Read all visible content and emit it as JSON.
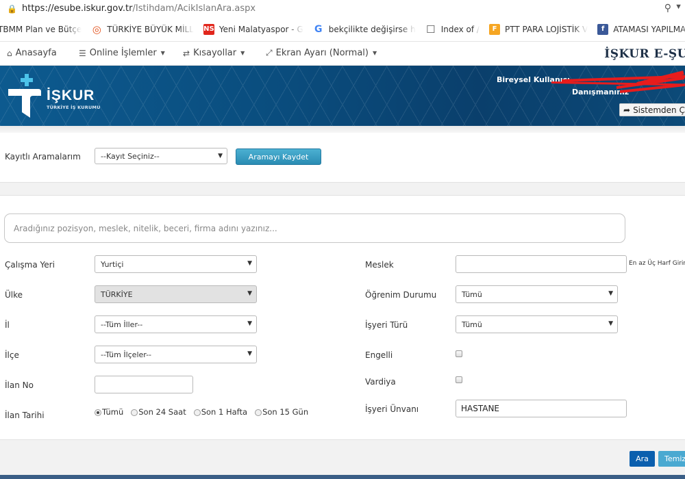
{
  "browser": {
    "url_host": "https://esube.iskur.gov.tr",
    "url_path": "/Istihdam/AcikIslanAra.aspx",
    "bookmarks": [
      {
        "label": "TBMM Plan ve Bütçe",
        "icon": "tbmm-icon",
        "color": "#ffffff"
      },
      {
        "label": "TÜRKİYE BÜYÜK MİLL",
        "icon": "tbmm-seal-icon",
        "color": "#e3541f"
      },
      {
        "label": "Yeni Malatyaspor - G",
        "icon": "malatyaspor-icon",
        "color": "#e1261c"
      },
      {
        "label": "bekçilikte değişirse h",
        "icon": "google-icon",
        "color": "#4285f4"
      },
      {
        "label": "Index of /",
        "icon": "document-icon",
        "color": "#555555"
      },
      {
        "label": "PTT PARA LOJİSTİK V",
        "icon": "ptt-icon",
        "color": "#f6a623"
      },
      {
        "label": "ATAMASI YAPILMAYA",
        "icon": "facebook-icon",
        "color": "#3b5998"
      }
    ]
  },
  "nav": {
    "home": "Anasayfa",
    "online": "Online İşlemler",
    "shortcuts": "Kısayollar",
    "screen": "Ekran Ayarı (Normal)",
    "brand": "İŞKUR E-ŞU"
  },
  "header": {
    "logo_text": "İŞKUR",
    "logo_sub": "TÜRKİYE İŞ KURUMU",
    "user_label": "Bireysel Kullanıcı",
    "consultant_label": "Danışmanınız",
    "logout": "Sistemden Ç"
  },
  "saved": {
    "label": "Kayıtlı Aramalarım",
    "select_value": "--Kayıt Seçiniz--",
    "save_button": "Aramayı Kaydet"
  },
  "search": {
    "placeholder": "Aradığınız pozisyon, meslek, nitelik, beceri, firma adını yazınız..."
  },
  "form": {
    "work_place_label": "Çalışma Yeri",
    "work_place_value": "Yurtiçi",
    "country_label": "Ülke",
    "country_value": "TÜRKİYE",
    "city_label": "İl",
    "city_value": "--Tüm İller--",
    "district_label": "İlçe",
    "district_value": "--Tüm İlçeler--",
    "listing_no_label": "İlan No",
    "listing_date_label": "İlan Tarihi",
    "date_options": [
      "Tümü",
      "Son 24 Saat",
      "Son 1 Hafta",
      "Son 15 Gün"
    ],
    "profession_label": "Meslek",
    "profession_hint": "En az Üç Harf Giriniz",
    "education_label": "Öğrenim Durumu",
    "education_value": "Tümü",
    "employer_type_label": "İşyeri Türü",
    "employer_type_value": "Tümü",
    "disabled_label": "Engelli",
    "shift_label": "Vardiya",
    "employer_title_label": "İşyeri Ünvanı",
    "employer_title_value": "HASTANE"
  },
  "actions": {
    "search": "Ara",
    "clear": "Temizle"
  }
}
